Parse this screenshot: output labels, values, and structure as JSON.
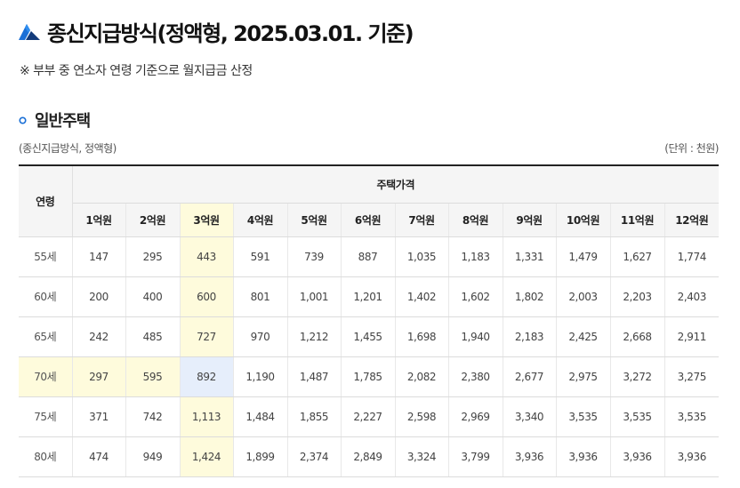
{
  "header": {
    "title": "종신지급방식(정액형, 2025.03.01. 기준)",
    "note": "※ 부부 중 연소자 연령 기준으로 월지급금 산정"
  },
  "section": {
    "title": "일반주택",
    "caption_left": "(종신지급방식, 정액형)",
    "caption_right": "(단위 : 천원)"
  },
  "table": {
    "age_header": "연령",
    "price_header": "주택가격",
    "columns": [
      "1억원",
      "2억원",
      "3억원",
      "4억원",
      "5억원",
      "6억원",
      "7억원",
      "8억원",
      "9억원",
      "10억원",
      "11억원",
      "12억원"
    ],
    "rows": [
      {
        "age": "55세",
        "values": [
          "147",
          "295",
          "443",
          "591",
          "739",
          "887",
          "1,035",
          "1,183",
          "1,331",
          "1,479",
          "1,627",
          "1,774"
        ]
      },
      {
        "age": "60세",
        "values": [
          "200",
          "400",
          "600",
          "801",
          "1,001",
          "1,201",
          "1,402",
          "1,602",
          "1,802",
          "2,003",
          "2,203",
          "2,403"
        ]
      },
      {
        "age": "65세",
        "values": [
          "242",
          "485",
          "727",
          "970",
          "1,212",
          "1,455",
          "1,698",
          "1,940",
          "2,183",
          "2,425",
          "2,668",
          "2,911"
        ]
      },
      {
        "age": "70세",
        "values": [
          "297",
          "595",
          "892",
          "1,190",
          "1,487",
          "1,785",
          "2,082",
          "2,380",
          "2,677",
          "2,975",
          "3,272",
          "3,275"
        ]
      },
      {
        "age": "75세",
        "values": [
          "371",
          "742",
          "1,113",
          "1,484",
          "1,855",
          "2,227",
          "2,598",
          "2,969",
          "3,340",
          "3,535",
          "3,535",
          "3,535"
        ]
      },
      {
        "age": "80세",
        "values": [
          "474",
          "949",
          "1,424",
          "1,899",
          "2,374",
          "2,849",
          "3,324",
          "3,799",
          "3,936",
          "3,936",
          "3,936",
          "3,936"
        ]
      }
    ]
  },
  "colors": {
    "highlight_column_and_row": "#fefbdc",
    "highlight_intersection": "#e6eefb",
    "logo_blue": "#1a6fd6",
    "logo_dark": "#123a7a"
  },
  "icons": {
    "logo": "brand-mountain-icon",
    "section_bullet": "circle-bullet-icon"
  }
}
